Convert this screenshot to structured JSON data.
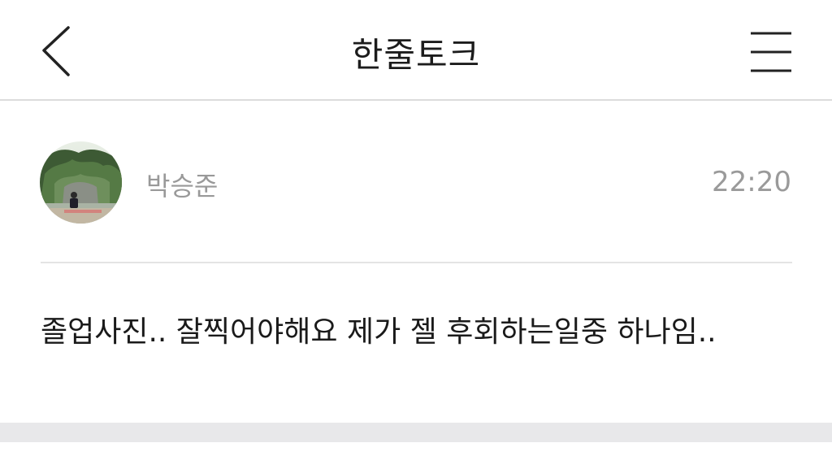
{
  "header": {
    "title": "한줄토크",
    "back_icon": "chevron-left-icon",
    "menu_icon": "hamburger-menu-icon"
  },
  "post": {
    "author": "박승준",
    "time": "22:20",
    "message": "졸업사진.. 잘찍어야해요 제가 젤 후회하는일중 하나임..",
    "avatar": "profile-photo-avatar"
  },
  "colors": {
    "header_border": "#dcdcdc",
    "meta_text": "#999999",
    "body_text": "#1a1a1a",
    "footer_band": "#e8e8ea"
  }
}
